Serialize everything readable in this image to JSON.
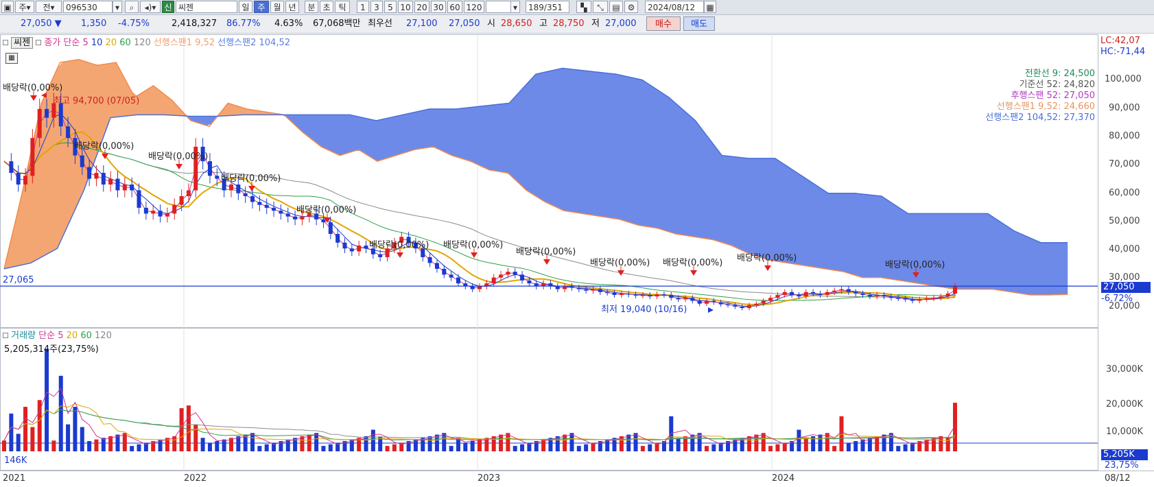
{
  "toolbar": {
    "kind_label": "주",
    "code_prefix": "전",
    "stock_code": "096530",
    "stock_name": "씨젠",
    "stock_tag": "신",
    "periods": [
      "일",
      "주",
      "월",
      "년",
      "분",
      "초",
      "틱"
    ],
    "selected_period": "주",
    "intervals": [
      "1",
      "3",
      "5",
      "10",
      "20",
      "30",
      "60",
      "120"
    ],
    "count": "189",
    "total": "/351",
    "date": "2024/08/12"
  },
  "quote": {
    "price": "27,050",
    "arrow": "▼",
    "change": "1,350",
    "change_pct": "-4.75%",
    "volume": "2,418,327",
    "vol_ratio": "86.77%",
    "turnover": "4.63%",
    "amount": "67,068백만",
    "best_label": "최우선",
    "ask": "27,100",
    "bid": "27,050",
    "open_label": "시",
    "open": "28,650",
    "high_label": "고",
    "high": "28,750",
    "low_label": "저",
    "low": "27,000",
    "buy_label": "매수",
    "sell_label": "매도"
  },
  "price_panel": {
    "title": "씨젠",
    "legend": [
      {
        "text": "종가 단순",
        "color": "#d0348c"
      },
      {
        "text": "5",
        "color": "#d0348c"
      },
      {
        "text": "10",
        "color": "#1c39c9"
      },
      {
        "text": "20",
        "color": "#e0a600"
      },
      {
        "text": "60",
        "color": "#2aa04a"
      },
      {
        "text": "120",
        "color": "#888888"
      },
      {
        "text": "선행스팬1 9,52",
        "color": "#f0a070"
      },
      {
        "text": "선행스팬2 104,52",
        "color": "#5a7de0"
      }
    ],
    "lc": "LC:42,07",
    "hc": "HC:-71,44",
    "ichimoku_info": [
      {
        "text": "전환선 9: 24,500",
        "color": "#1f8a5a"
      },
      {
        "text": "기준선 52: 24,820",
        "color": "#555555"
      },
      {
        "text": "후행스팬 52: 27,050",
        "color": "#b03ac0"
      },
      {
        "text": "선행스팬1 9,52: 24,660",
        "color": "#e89560"
      },
      {
        "text": "선행스팬2 104,52: 27,370",
        "color": "#4a6fd8"
      }
    ],
    "high_marker": "최고 94,700 (07/05)",
    "low_marker": "최저 19,040 (10/16)",
    "last_price_label": "27,065",
    "current_price_tag": "27,050",
    "current_pct_tag": "-6.72%",
    "dividend_label": "배당락(0,00%)",
    "y_ticks": [
      "100,000",
      "90,000",
      "80,000",
      "70,000",
      "60,000",
      "50,000",
      "40,000",
      "30,000",
      "20,000"
    ]
  },
  "volume_panel": {
    "legend": [
      {
        "text": "거래량",
        "color": "#1a8a9a"
      },
      {
        "text": "단순",
        "color": "#d0348c"
      },
      {
        "text": "5",
        "color": "#d0348c"
      },
      {
        "text": "20",
        "color": "#e0a600"
      },
      {
        "text": "60",
        "color": "#2aa04a"
      },
      {
        "text": "120",
        "color": "#888888"
      }
    ],
    "max_label": "5,205,314주(23,75%)",
    "min_label": "146K",
    "y_ticks": [
      "30,000K",
      "20,000K",
      "10,000K"
    ],
    "current_tag": "5,205K",
    "current_pct": "23,75%"
  },
  "x_axis": {
    "labels": [
      "2021",
      "2022",
      "2023",
      "2024"
    ],
    "end_label": "08/12"
  },
  "chart_data": {
    "type": "candlestick",
    "title": "씨젠",
    "y_range": [
      15000,
      107000
    ],
    "y_ticks": [
      100000,
      90000,
      80000,
      70000,
      60000,
      50000,
      40000,
      30000,
      20000
    ],
    "x_labels": [
      "2021",
      "2022",
      "2023",
      "2024"
    ],
    "last_close": 27050,
    "high": 94700,
    "high_date": "07/05",
    "low": 19040,
    "low_date": "10/16",
    "close_series_weekly": [
      70000,
      66000,
      62000,
      65000,
      78000,
      88000,
      85000,
      90000,
      82000,
      78000,
      72000,
      68000,
      64000,
      66000,
      62000,
      64000,
      60000,
      62000,
      60000,
      54000,
      52000,
      53000,
      51000,
      52000,
      55000,
      58000,
      60000,
      75000,
      70000,
      65000,
      64000,
      60000,
      62000,
      59000,
      58000,
      56000,
      55000,
      54000,
      53000,
      52000,
      51000,
      50000,
      51000,
      52000,
      50000,
      49000,
      45000,
      42000,
      40000,
      39000,
      41000,
      40000,
      38000,
      37000,
      40000,
      42000,
      44000,
      42000,
      40000,
      37000,
      35000,
      33000,
      31000,
      30000,
      28000,
      27000,
      26000,
      27000,
      28000,
      30000,
      31000,
      32000,
      31000,
      29000,
      28000,
      27000,
      28000,
      27000,
      26000,
      27000,
      26500,
      26000,
      25500,
      26000,
      25000,
      24800,
      24000,
      24500,
      24200,
      23800,
      24000,
      23500,
      24200,
      24000,
      23000,
      22500,
      23000,
      22000,
      21000,
      22000,
      21500,
      20800,
      20500,
      20000,
      19500,
      20500,
      21000,
      22000,
      23000,
      24000,
      25000,
      24000,
      23500,
      25000,
      24500,
      24000,
      25000,
      25500,
      26000,
      25000,
      24500,
      24000,
      23500,
      24000,
      23500,
      23000,
      22800,
      22500,
      22000,
      22500,
      22800,
      23000,
      23500,
      24500,
      27050
    ],
    "leading_span1_weekly": [
      33000,
      60000,
      90000,
      104000,
      105000,
      103000,
      104000,
      92000,
      96000,
      91000,
      84000,
      82000,
      90000,
      88000,
      87000,
      86000,
      80000,
      75000,
      72000,
      74000,
      70000,
      72000,
      74000,
      75000,
      72000,
      70000,
      67000,
      66000,
      60000,
      56000,
      53000,
      52000,
      51000,
      50000,
      48000,
      47000,
      45000,
      44000,
      43000,
      41000,
      38000,
      36000,
      35000,
      34000,
      33000,
      32000,
      30000,
      30000,
      29000,
      28000,
      27000,
      26000,
      26000,
      26000,
      25000,
      24000,
      24000,
      24200
    ],
    "leading_span2_weekly": [
      33000,
      35000,
      40000,
      60000,
      85000,
      86000,
      86000,
      85500,
      85500,
      86000,
      86000,
      86000,
      86000,
      86000,
      84000,
      86000,
      88000,
      88000,
      89000,
      90000,
      100000,
      102000,
      101000,
      100000,
      98000,
      92000,
      84000,
      72000,
      71000,
      71000,
      65000,
      59000,
      59000,
      58000,
      52000,
      52000,
      52000,
      52000,
      46000,
      42000,
      42000
    ],
    "dividends_count": 12,
    "volume": {
      "type": "bar",
      "max_label": "5,205,314주(23,75%)",
      "y_ticks": [
        30000,
        20000,
        10000
      ],
      "last": 5205
    }
  }
}
